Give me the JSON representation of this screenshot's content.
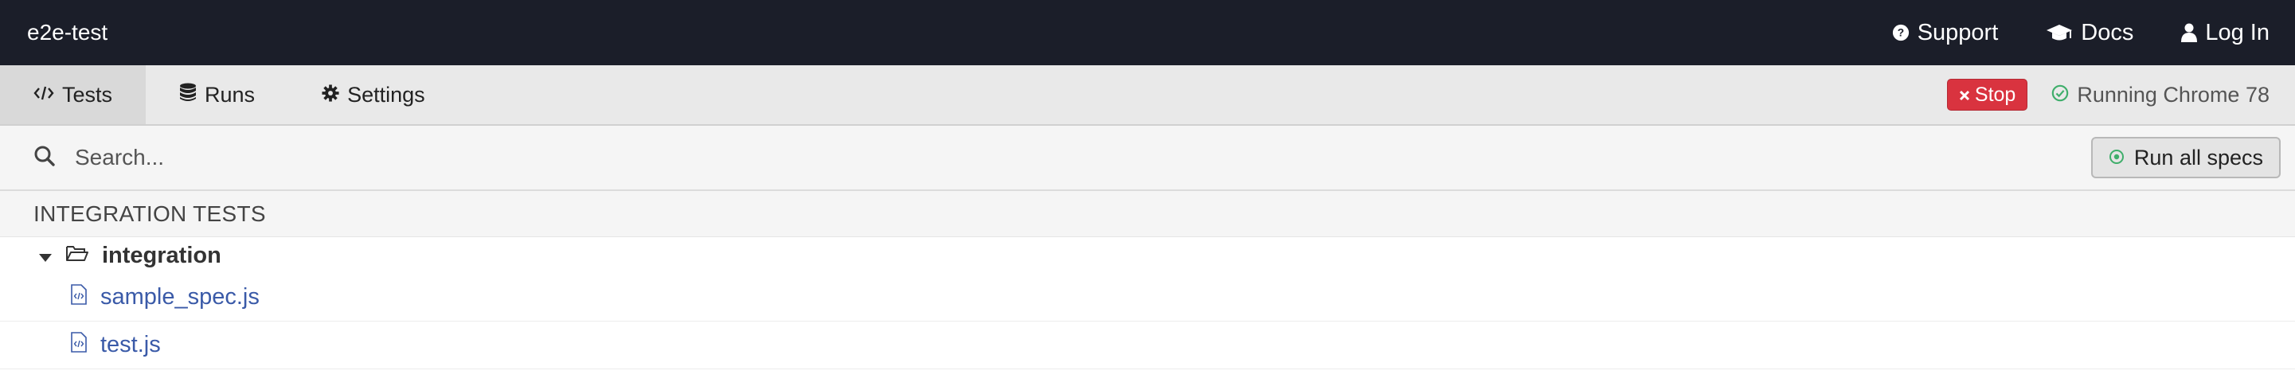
{
  "header": {
    "project_name": "e2e-test",
    "nav": [
      {
        "label": "Support",
        "icon": "question-circle-icon"
      },
      {
        "label": "Docs",
        "icon": "graduation-cap-icon"
      },
      {
        "label": "Log In",
        "icon": "user-icon"
      }
    ]
  },
  "tabs": [
    {
      "label": "Tests",
      "icon": "code-icon",
      "active": true
    },
    {
      "label": "Runs",
      "icon": "database-icon",
      "active": false
    },
    {
      "label": "Settings",
      "icon": "gear-icon",
      "active": false
    }
  ],
  "status": {
    "stop_label": "Stop",
    "browser_status": "Running Chrome 78"
  },
  "search": {
    "placeholder": "Search...",
    "run_all_label": "Run all specs"
  },
  "specs": {
    "section_title": "INTEGRATION TESTS",
    "folder_name": "integration",
    "files": [
      "sample_spec.js",
      "test.js"
    ]
  },
  "colors": {
    "header_bg": "#1b1e29",
    "stop_red": "#d9333f",
    "running_green": "#3fae6b",
    "spec_link": "#3a5aa8"
  }
}
